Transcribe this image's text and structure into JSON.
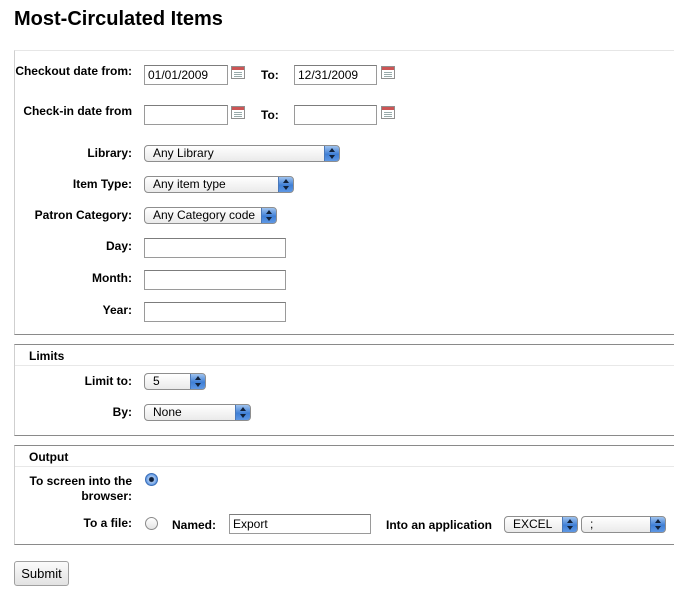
{
  "page": {
    "title": "Most-Circulated Items"
  },
  "filters": {
    "checkout_label": "Checkout date from:",
    "checkout_from": "01/01/2009",
    "checkout_to": "12/31/2009",
    "checkin_label": "Check-in date from",
    "checkin_from": "",
    "checkin_to": "",
    "to_label": "To:",
    "library_label": "Library:",
    "library_value": "Any Library",
    "item_type_label": "Item Type:",
    "item_type_value": "Any item type",
    "patron_category_label": "Patron Category:",
    "patron_category_value": "Any Category code",
    "day_label": "Day:",
    "month_label": "Month:",
    "year_label": "Year:",
    "day_value": "",
    "month_value": "",
    "year_value": ""
  },
  "limits": {
    "legend": "Limits",
    "limit_to_label": "Limit to:",
    "limit_to_value": "5",
    "by_label": "By:",
    "by_value": "None"
  },
  "output": {
    "legend": "Output",
    "screen_label": "To screen into the browser:",
    "file_label": "To a file:",
    "named_label": "Named:",
    "named_value": "Export",
    "app_label": "Into an application",
    "app_value": "EXCEL",
    "separator_value": ";"
  },
  "actions": {
    "submit_label": "Submit"
  },
  "icons": {
    "calendar": "calendar-icon",
    "select_arrows": "up-down-arrows-icon",
    "radio": "radio-icon"
  }
}
